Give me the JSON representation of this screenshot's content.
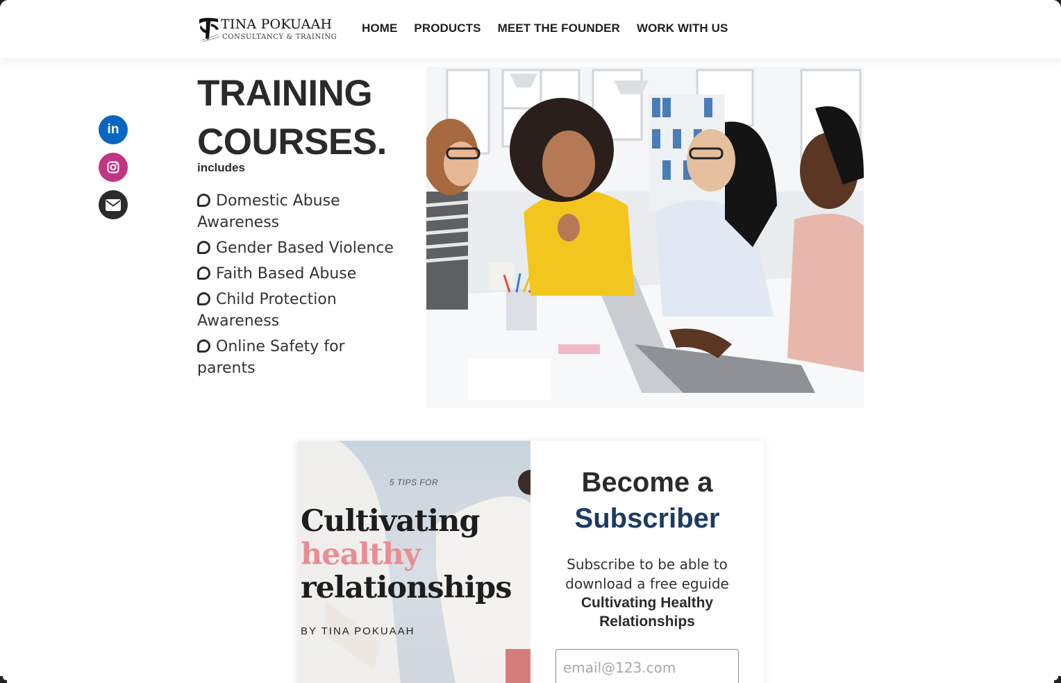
{
  "brand": {
    "name": "TINA POKUAAH",
    "tagline": "CONSULTANCY & TRAINING"
  },
  "nav": {
    "items": [
      {
        "label": "HOME"
      },
      {
        "label": "PRODUCTS"
      },
      {
        "label": "MEET THE FOUNDER"
      },
      {
        "label": "WORK WITH US"
      }
    ]
  },
  "social": {
    "linkedin_icon": "linkedin-icon",
    "linkedin_glyph": "in",
    "instagram_icon": "instagram-icon",
    "email_icon": "envelope-icon",
    "colors": {
      "linkedin": "#0a66c2",
      "instagram": "#c13584",
      "email": "#2b2b2b"
    }
  },
  "training": {
    "title_line1": "TRAINING",
    "title_line2": "COURSES.",
    "includes": "includes",
    "courses": [
      "Domestic Abuse Awareness",
      "Gender Based Violence",
      "Faith Based Abuse",
      "Child Protection Awareness",
      "Online Safety for parents"
    ]
  },
  "ebook": {
    "kicker": "5 TIPS FOR",
    "title_line1": "Cultivating",
    "title_line2": "healthy",
    "title_line3": "relationships",
    "author": "BY TINA POKUAAH",
    "accent_color": "#ea8c92"
  },
  "subscribe": {
    "heading_line1": "Become a",
    "heading_line2": "Subscriber",
    "description": "Subscribe to be able to download a free eguide",
    "guide_title": "Cultivating Healthy Relationships",
    "email_placeholder": "email@123.com",
    "accent_color": "#1c3b62"
  }
}
